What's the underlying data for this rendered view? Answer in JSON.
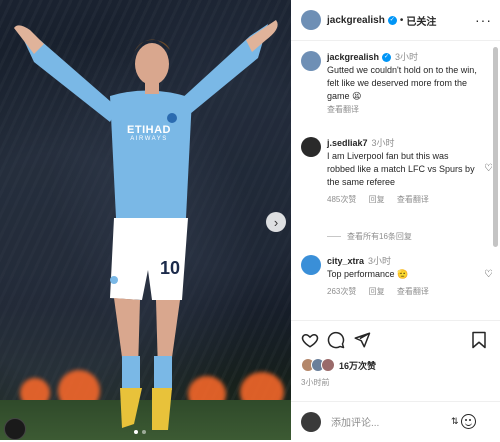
{
  "post": {
    "username": "jackgrealish",
    "follow_status": "已关注",
    "separator": "•",
    "more_label": "···"
  },
  "media": {
    "shirt_sponsor_line1": "ETIHAD",
    "shirt_sponsor_line2": "AIRWAYS",
    "shorts_number": "10",
    "next_icon": "chevron-right-icon"
  },
  "comments": [
    {
      "username": "jackgrealish",
      "time": "3小时",
      "text": "Gutted we couldn't hold on to the win, felt like we deserved more from the game 😫",
      "translate": "查看翻译"
    },
    {
      "username": "j.sedliak7",
      "time": "3小时",
      "text": "I am Liverpool fan but this was robbed like a match LFC vs Spurs by the same referee",
      "likes": "485次赞",
      "reply": "回复",
      "translate": "查看翻译"
    },
    {
      "username": "city_xtra",
      "time": "3小时",
      "text": "Top performance 🫡",
      "likes": "263次赞",
      "reply": "回复",
      "translate": "查看翻译"
    }
  ],
  "view_replies": "查看所有16条回复",
  "likes_count": "16万次赞",
  "posted_ago": "3小时前",
  "add_comment_placeholder": "添加评论...",
  "colors": {
    "verified": "#0095f6",
    "city_blue": "#7ab8e6"
  }
}
